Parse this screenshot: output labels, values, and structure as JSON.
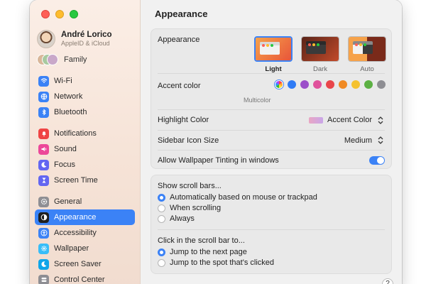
{
  "window": {
    "title": "Appearance"
  },
  "sidebar": {
    "user": {
      "name": "André Lorico",
      "subtitle": "AppleID & iCloud"
    },
    "family_label": "Family",
    "groups": [
      [
        {
          "label": "Wi-Fi",
          "icon": "wifi-icon",
          "color": "#3b82f6"
        },
        {
          "label": "Network",
          "icon": "globe-icon",
          "color": "#3b82f6"
        },
        {
          "label": "Bluetooth",
          "icon": "bluetooth-icon",
          "color": "#3b82f6"
        }
      ],
      [
        {
          "label": "Notifications",
          "icon": "bell-icon",
          "color": "#ef4444"
        },
        {
          "label": "Sound",
          "icon": "speaker-icon",
          "color": "#ec4899"
        },
        {
          "label": "Focus",
          "icon": "moon-icon",
          "color": "#6366f1"
        },
        {
          "label": "Screen Time",
          "icon": "hourglass-icon",
          "color": "#6366f1"
        }
      ],
      [
        {
          "label": "General",
          "icon": "gear-icon",
          "color": "#8e8e93"
        },
        {
          "label": "Appearance",
          "icon": "appearance-icon",
          "color": "#1f1f1f",
          "active": true
        },
        {
          "label": "Accessibility",
          "icon": "accessibility-icon",
          "color": "#3b82f6"
        },
        {
          "label": "Wallpaper",
          "icon": "wallpaper-icon",
          "color": "#38bdf8"
        },
        {
          "label": "Screen Saver",
          "icon": "screensaver-icon",
          "color": "#0ea5e9"
        },
        {
          "label": "Control Center",
          "icon": "control-center-icon",
          "color": "#8e8e93"
        }
      ]
    ]
  },
  "appearance": {
    "label": "Appearance",
    "options": [
      {
        "label": "Light",
        "selected": true
      },
      {
        "label": "Dark",
        "selected": false
      },
      {
        "label": "Auto",
        "selected": false
      }
    ]
  },
  "accent": {
    "label": "Accent color",
    "selected_label": "Multicolor",
    "colors": [
      "multicolor",
      "#2f7bf5",
      "#9b4fc9",
      "#e0529c",
      "#e9464b",
      "#f08a24",
      "#f5c230",
      "#5cb043",
      "#8e8e93"
    ]
  },
  "highlight": {
    "label": "Highlight Color",
    "value": "Accent Color"
  },
  "sidebar_icon_size": {
    "label": "Sidebar Icon Size",
    "value": "Medium"
  },
  "tinting": {
    "label": "Allow Wallpaper Tinting in windows",
    "enabled": true
  },
  "scroll_bars": {
    "label": "Show scroll bars...",
    "options": [
      {
        "label": "Automatically based on mouse or trackpad",
        "selected": true
      },
      {
        "label": "When scrolling",
        "selected": false
      },
      {
        "label": "Always",
        "selected": false
      }
    ]
  },
  "click_scroll": {
    "label": "Click in the scroll bar to...",
    "options": [
      {
        "label": "Jump to the next page",
        "selected": true
      },
      {
        "label": "Jump to the spot that's clicked",
        "selected": false
      }
    ]
  },
  "help_label": "?"
}
